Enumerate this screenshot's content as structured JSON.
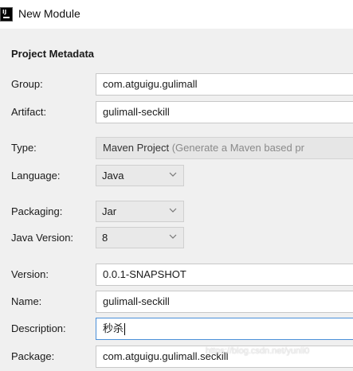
{
  "window": {
    "title": "New Module"
  },
  "section": {
    "heading": "Project Metadata"
  },
  "form": {
    "group": {
      "label": "Group:",
      "value": "com.atguigu.gulimall"
    },
    "artifact": {
      "label": "Artifact:",
      "value": "gulimall-seckill"
    },
    "type": {
      "label": "Type:",
      "value": "Maven Project",
      "hint": "(Generate a Maven based pr"
    },
    "language": {
      "label": "Language:",
      "value": "Java"
    },
    "packaging": {
      "label": "Packaging:",
      "value": "Jar"
    },
    "java_version": {
      "label": "Java Version:",
      "value": "8"
    },
    "version": {
      "label": "Version:",
      "value": "0.0.1-SNAPSHOT"
    },
    "name": {
      "label": "Name:",
      "value": "gulimall-seckill"
    },
    "description": {
      "label": "Description:",
      "value": "秒杀"
    },
    "package": {
      "label": "Package:",
      "value": "com.atguigu.gulimall.seckill"
    }
  },
  "watermark": "https://blog.csdn.net/yunli0"
}
